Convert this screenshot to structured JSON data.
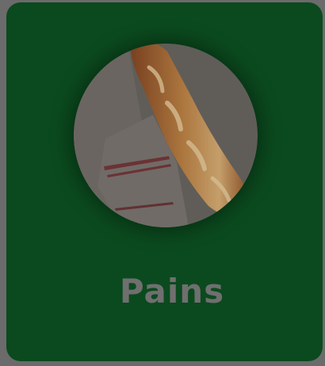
{
  "category_card": {
    "title": "Pains",
    "image_icon": "baguette-photo",
    "colors": {
      "card_background": "#0b4a1e",
      "overlay": "#6b6b6b",
      "title": "#6f6f6f"
    }
  }
}
